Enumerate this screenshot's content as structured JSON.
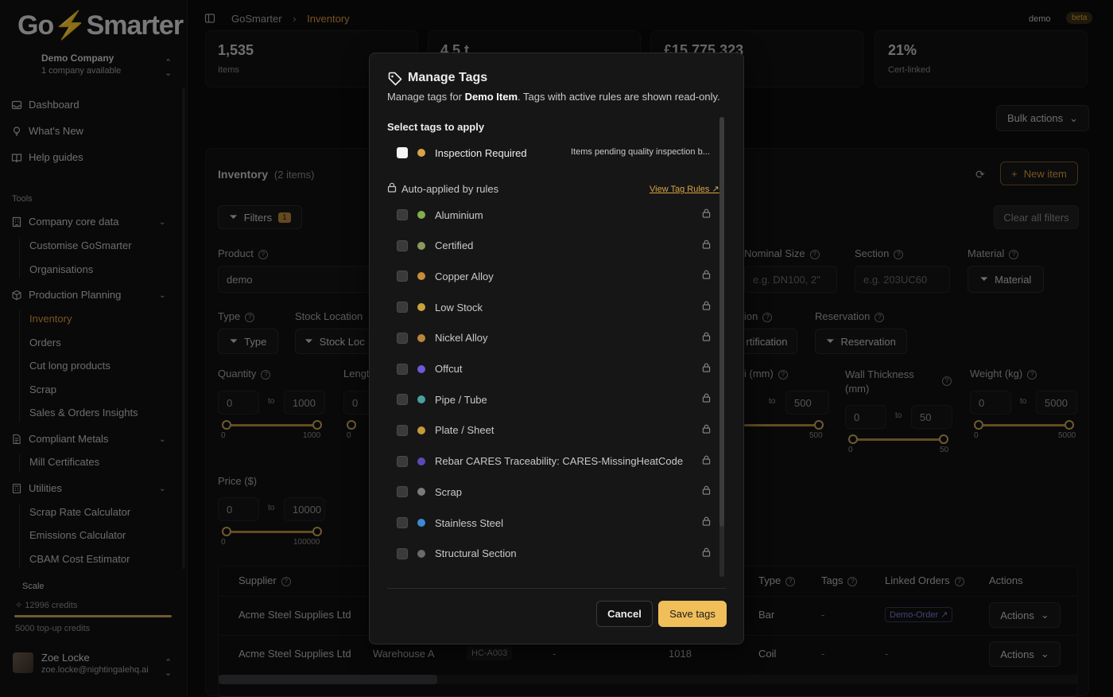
{
  "sidebar": {
    "logo": "GoSmarter",
    "company": {
      "name": "Demo Company",
      "sub": "1 company available"
    },
    "top_items": [
      {
        "label": "Dashboard",
        "icon": "inbox-icon"
      },
      {
        "label": "What's New",
        "icon": "lightbulb-icon"
      },
      {
        "label": "Help guides",
        "icon": "book-icon"
      }
    ],
    "tools_label": "Tools",
    "groups": [
      {
        "label": "Company core data",
        "icon": "building-icon",
        "items": [
          "Customise GoSmarter",
          "Organisations"
        ]
      },
      {
        "label": "Production Planning",
        "icon": "box-icon",
        "items": [
          "Inventory",
          "Orders",
          "Cut long products",
          "Scrap",
          "Sales & Orders Insights"
        ]
      },
      {
        "label": "Compliant Metals",
        "icon": "document-icon",
        "items": [
          "Mill Certificates"
        ]
      },
      {
        "label": "Utilities",
        "icon": "calculator-icon",
        "items": [
          "Scrap Rate Calculator",
          "Emissions Calculator",
          "CBAM Cost Estimator"
        ]
      }
    ],
    "active_item": "Inventory",
    "scale": {
      "label": "Scale",
      "credits": "12996 credits",
      "topup": "5000 top-up credits",
      "fill": 1.0
    },
    "user": {
      "name": "Zoe Locke",
      "email": "zoe.locke@nightingalehq.ai"
    }
  },
  "header": {
    "breadcrumb": [
      "GoSmarter",
      "Inventory"
    ],
    "user_label": "demo",
    "badge": "beta"
  },
  "stats": [
    {
      "value": "1,535",
      "label": "Items"
    },
    {
      "value": "4.5 t",
      "label": ""
    },
    {
      "value": "£15,775,323",
      "label": ""
    },
    {
      "value": "21%",
      "label": "Cert-linked"
    }
  ],
  "bulk_actions": "Bulk actions",
  "inventory": {
    "title": "Inventory",
    "count": "(2 items)",
    "new_item": "New item",
    "filters_label": "Filters",
    "filters_count": "1",
    "clear_filters": "Clear all filters",
    "product_label": "Product",
    "product_value": "demo",
    "nominal_label": "Nominal Size",
    "nominal_placeholder": "e.g. DN100, 2\"",
    "section_label": "Section",
    "section_placeholder": "e.g. 203UC60",
    "material_label": "Material",
    "material_button": "Material",
    "type_label": "Type",
    "type_button": "Type",
    "stock_label": "Stock Location",
    "stock_button": "Stock Loc",
    "cert_label": "ion",
    "cert_button": "rtification",
    "reservation_label": "Reservation",
    "reservation_button": "Reservation",
    "quantity": {
      "label": "Quantity",
      "min": "0",
      "max": "1000",
      "tmin": "0",
      "tmax": "1000"
    },
    "length": {
      "label": "Lengt",
      "min": "0",
      "tmin": "0"
    },
    "diam": {
      "label": "i (mm)",
      "max": "500",
      "tmax": "500"
    },
    "wall": {
      "label": "Wall Thickness (mm)",
      "min": "0",
      "max": "50",
      "tmin": "0",
      "tmax": "50"
    },
    "weight": {
      "label": "Weight (kg)",
      "min": "0",
      "max": "5000",
      "tmin": "0",
      "tmax": "5000"
    },
    "price": {
      "label": "Price ($)",
      "min": "0",
      "max": "10000",
      "tmin": "0",
      "tmax": "100000"
    },
    "to": "to",
    "table": {
      "headers": {
        "supplier": "Supplier",
        "type": "Type",
        "tags": "Tags",
        "linked": "Linked Orders",
        "actions": "Actions"
      },
      "rows": [
        {
          "supplier": "Acme Steel Supplies Ltd",
          "location": "",
          "code": "",
          "dash": "",
          "qty": "",
          "type": "Bar",
          "tags": "-",
          "linked": "Demo-Order",
          "actions": "Actions"
        },
        {
          "supplier": "Acme Steel Supplies Ltd",
          "location": "Warehouse A",
          "code": "HC-A003",
          "dash": "-",
          "qty": "1018",
          "type": "Coil",
          "tags": "-",
          "linked": "-",
          "actions": "Actions"
        }
      ]
    }
  },
  "modal": {
    "title": "Manage Tags",
    "desc_pre": "Manage tags for ",
    "desc_item": "Demo Item",
    "desc_post": ". Tags with active rules are shown read-only.",
    "select_label": "Select tags to apply",
    "selectable": [
      {
        "name": "Inspection Required",
        "color": "#d9a441",
        "desc": "Items pending quality inspection b..."
      }
    ],
    "auto_label": "Auto-applied by rules",
    "view_rules": "View Tag Rules",
    "auto_tags": [
      {
        "name": "Aluminium",
        "color": "#7fb04a"
      },
      {
        "name": "Certified",
        "color": "#8a9a5b"
      },
      {
        "name": "Copper Alloy",
        "color": "#c98a3a"
      },
      {
        "name": "Low Stock",
        "color": "#c9a23a"
      },
      {
        "name": "Nickel Alloy",
        "color": "#b8863a"
      },
      {
        "name": "Offcut",
        "color": "#6a5ad6"
      },
      {
        "name": "Pipe / Tube",
        "color": "#4aa0a0"
      },
      {
        "name": "Plate / Sheet",
        "color": "#c49a3a"
      },
      {
        "name": "Rebar CARES Traceability: CARES-MissingHeatCode",
        "color": "#5a4ab8"
      },
      {
        "name": "Scrap",
        "color": "#7a7a7e"
      },
      {
        "name": "Stainless Steel",
        "color": "#3a8ad6"
      },
      {
        "name": "Structural Section",
        "color": "#6a6a6e"
      }
    ],
    "cancel": "Cancel",
    "save": "Save tags"
  }
}
